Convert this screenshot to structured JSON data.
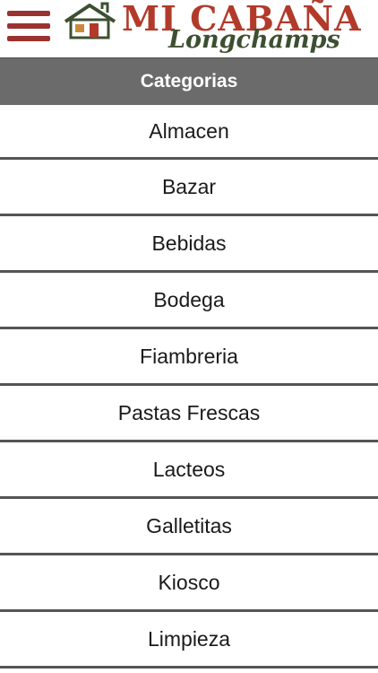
{
  "header": {
    "logo": {
      "title": "MI CABAÑA",
      "subtitle": "Longchamps"
    },
    "menu_icon": "hamburger-menu-icon"
  },
  "section": {
    "title": "Categorias"
  },
  "categories": [
    {
      "label": "Almacen"
    },
    {
      "label": "Bazar"
    },
    {
      "label": "Bebidas"
    },
    {
      "label": "Bodega"
    },
    {
      "label": "Fiambreria"
    },
    {
      "label": "Pastas Frescas"
    },
    {
      "label": "Lacteos"
    },
    {
      "label": "Galletitas"
    },
    {
      "label": "Kiosco"
    },
    {
      "label": "Limpieza"
    }
  ],
  "colors": {
    "brand_red": "#b23a2a",
    "brand_green": "#3d4f31",
    "menu_icon": "#9b3230",
    "header_bar": "#6b6b6b",
    "divider": "#555555"
  }
}
